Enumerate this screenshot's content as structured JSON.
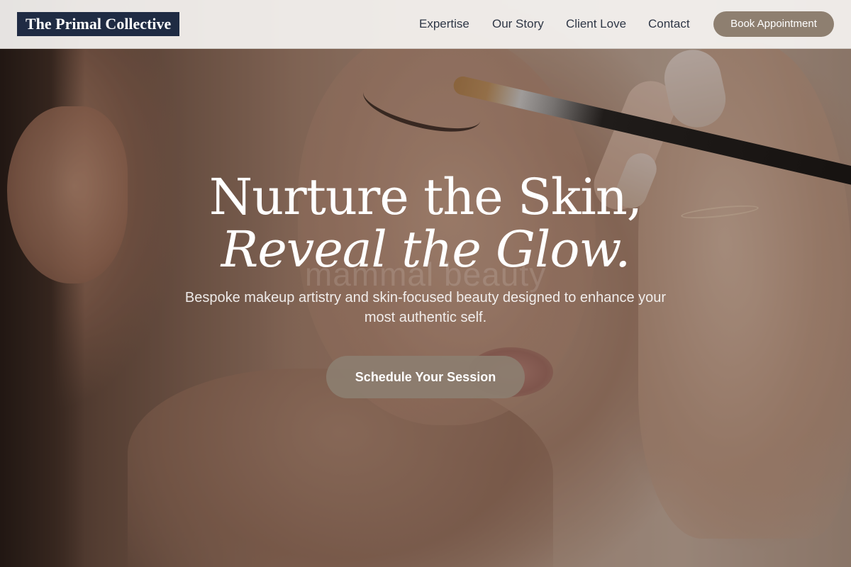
{
  "header": {
    "logo_text": "The Primal Collective",
    "nav": [
      {
        "label": "Expertise"
      },
      {
        "label": "Our Story"
      },
      {
        "label": "Client Love"
      },
      {
        "label": "Contact"
      }
    ],
    "cta_label": "Book Appointment"
  },
  "hero": {
    "title_line1": "Nurture the Skin,",
    "title_line2": "Reveal the Glow.",
    "background_text": "mammal beauty",
    "subtitle": "Bespoke makeup artistry and skin-focused beauty designed to enhance your most authentic self.",
    "cta_label": "Schedule Your Session"
  },
  "colors": {
    "logo_bg": "#1f2b43",
    "accent": "#8e7f70",
    "nav_text": "#2f3746"
  }
}
